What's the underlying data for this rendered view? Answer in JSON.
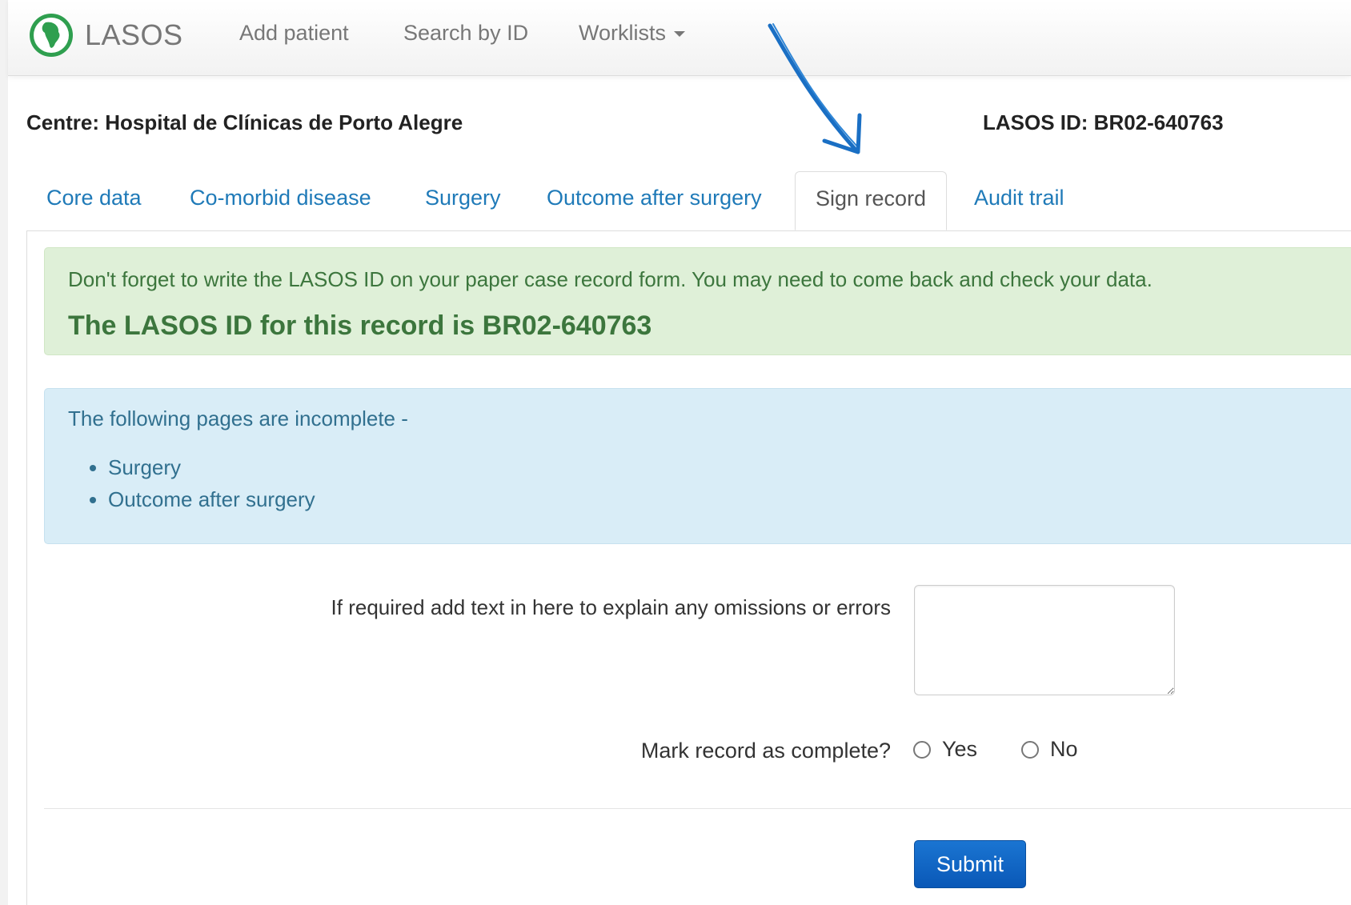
{
  "navbar": {
    "brand": "LASOS",
    "add_patient": "Add patient",
    "search_by_id": "Search by ID",
    "worklists": "Worklists"
  },
  "header": {
    "centre": "Centre: Hospital de Clínicas de Porto Alegre",
    "lasos_id": "LASOS ID: BR02-640763"
  },
  "tabs": [
    {
      "label": "Core data"
    },
    {
      "label": "Co-morbid disease"
    },
    {
      "label": "Surgery"
    },
    {
      "label": "Outcome after surgery"
    },
    {
      "label": "Sign record",
      "active": true
    },
    {
      "label": "Audit trail"
    }
  ],
  "alert_success": {
    "message": "Don't forget to write the LASOS ID on your paper case record form. You may need to come back and check your data.",
    "strong": "The LASOS ID for this record is BR02-640763"
  },
  "alert_info": {
    "heading": "The following pages are incomplete -",
    "items": [
      "Surgery",
      "Outcome after surgery"
    ]
  },
  "form": {
    "omissions_label": "If required add text in here to explain any omissions or errors",
    "omissions_value": "",
    "complete_label": "Mark record as complete?",
    "yes": "Yes",
    "no": "No",
    "submit": "Submit"
  },
  "colors": {
    "link": "#1f7ab8",
    "success_bg": "#dff0d8",
    "success_text": "#3c763d",
    "info_bg": "#d9edf7",
    "info_text": "#31708f",
    "primary": "#0a58b7",
    "annotation_arrow": "#1a6fc4"
  }
}
